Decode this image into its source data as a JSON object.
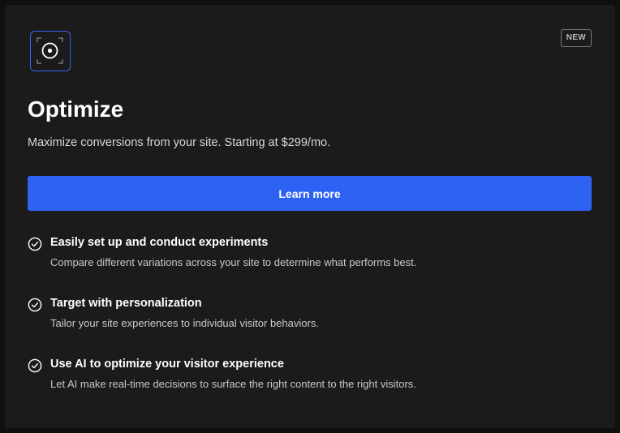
{
  "card": {
    "badge": "NEW",
    "logo_icon": "target-frame-icon",
    "title": "Optimize",
    "subtitle": "Maximize conversions from your site. Starting at $299/mo.",
    "cta_label": "Learn more"
  },
  "features": [
    {
      "icon": "check-circle-icon",
      "title": "Easily set up and conduct experiments",
      "description": "Compare different variations across your site to determine what performs best."
    },
    {
      "icon": "check-circle-icon",
      "title": "Target with personalization",
      "description": "Tailor your site experiences to individual visitor behaviors."
    },
    {
      "icon": "check-circle-icon",
      "title": "Use AI to optimize your visitor experience",
      "description": "Let AI make real-time decisions to surface the right content to the right visitors."
    }
  ],
  "colors": {
    "background": "#1b1b1b",
    "accent": "#2e62f2",
    "logo_border": "#3a63f0",
    "text_primary": "#ffffff",
    "text_secondary": "#c9c9c9"
  }
}
